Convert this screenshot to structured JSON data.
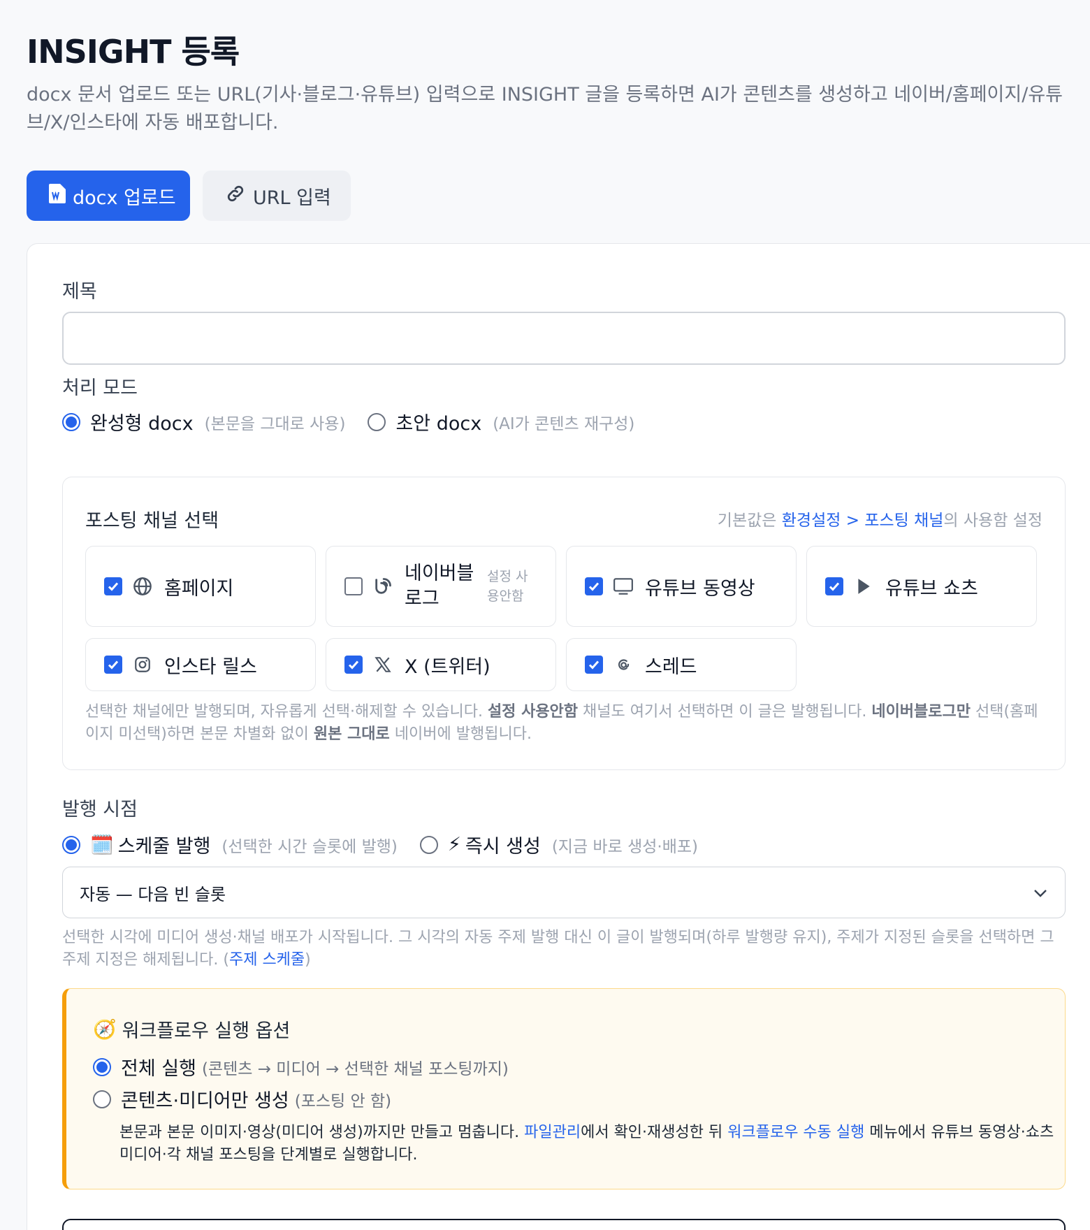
{
  "header": {
    "title": "INSIGHT 등록",
    "description": "docx 문서 업로드 또는 URL(기사·블로그·유튜브) 입력으로 INSIGHT 글을 등록하면 AI가 콘텐츠를 생성하고 네이버/홈페이지/유튜브/X/인스타에 자동 배포합니다."
  },
  "tabs": [
    {
      "label": "docx 업로드",
      "icon": "word-file-icon",
      "active": true
    },
    {
      "label": "URL 입력",
      "icon": "link-icon",
      "active": false
    }
  ],
  "form": {
    "title_label": "제목",
    "title_value": "",
    "mode_label": "처리 모드",
    "modes": [
      {
        "label": "완성형 docx",
        "hint": "(본문을 그대로 사용)",
        "selected": true
      },
      {
        "label": "초안 docx",
        "hint": "(AI가 콘텐츠 재구성)",
        "selected": false
      }
    ]
  },
  "channels": {
    "title": "포스팅 채널 선택",
    "note_prefix": "기본값은 ",
    "note_link": "환경설정 > 포스팅 채널",
    "note_suffix": "의 사용함 설정",
    "items": [
      {
        "label": "홈페이지",
        "icon": "globe-icon",
        "checked": true
      },
      {
        "label": "네이버블로그",
        "icon": "blog-icon",
        "checked": false,
        "sub": "설정 사용안함"
      },
      {
        "label": "유튜브 동영상",
        "icon": "monitor-icon",
        "checked": true
      },
      {
        "label": "유튜브 쇼츠",
        "icon": "play-icon",
        "checked": true
      },
      {
        "label": "인스타 릴스",
        "icon": "instagram-icon",
        "checked": true
      },
      {
        "label": "X (트위터)",
        "icon": "x-logo-icon",
        "checked": true
      },
      {
        "label": "스레드",
        "icon": "threads-icon",
        "checked": true
      }
    ],
    "help": {
      "p1": "선택한 채널에만 발행되며, 자유롭게 선택·해제할 수 있습니다. ",
      "b1": "설정 사용안함",
      "p2": " 채널도 여기서 선택하면 이 글은 발행됩니다. ",
      "b2": "네이버블로그만",
      "p3": " 선택(홈페이지 미선택)하면 본문 차별화 없이 ",
      "b3": "원본 그대로",
      "p4": " 네이버에 발행됩니다."
    }
  },
  "publish": {
    "label": "발행 시점",
    "options": [
      {
        "icon": "🗓️",
        "label": "스케줄 발행",
        "hint": "(선택한 시간 슬롯에 발행)",
        "selected": true
      },
      {
        "icon": "⚡",
        "label": "즉시 생성",
        "hint": "(지금 바로 생성·배포)",
        "selected": false
      }
    ],
    "select_value": "자동 — 다음 빈 슬롯",
    "help_text": "선택한 시각에 미디어 생성·채널 배포가 시작됩니다. 그 시각의 자동 주제 발행 대신 이 글이 발행되며(하루 발행량 유지), 주제가 지정된 슬롯을 선택하면 그 주제 지정은 해제됩니다. (",
    "help_link": "주제 스케줄",
    "help_end": ")"
  },
  "workflow": {
    "icon": "🧭",
    "title": "워크플로우 실행 옵션",
    "options": [
      {
        "label": "전체 실행",
        "hint": "(콘텐츠 → 미디어 → 선택한 채널 포스팅까지)",
        "selected": true
      },
      {
        "label": "콘텐츠·미디어만 생성",
        "hint": "(포스팅 안 함)",
        "selected": false
      }
    ],
    "desc_p1": "본문과 본문 이미지·영상(미디어 생성)까지만 만들고 멈춥니다. ",
    "desc_link1": "파일관리",
    "desc_p2": "에서 확인·재생성한 뒤 ",
    "desc_link2": "워크플로우 수동 실행",
    "desc_p3": " 메뉴에서 유튜브 동영상·쇼츠 미디어·각 채널 포스팅을 단계별로 실행합니다."
  },
  "colors": {
    "accent": "#2563eb",
    "warning_border": "#f59e0b",
    "warning_bg": "#fefaf0"
  }
}
